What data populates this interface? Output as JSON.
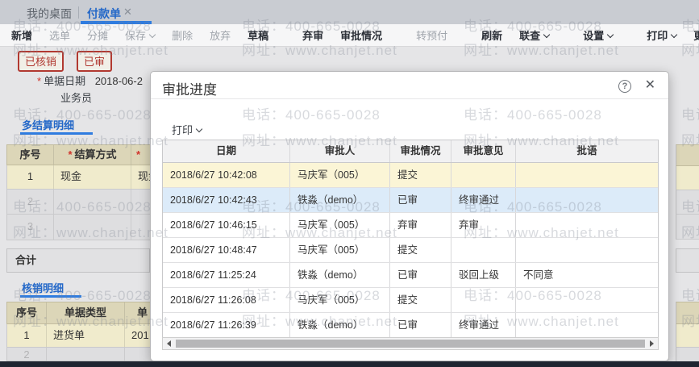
{
  "tabs": [
    {
      "label": "我的桌面"
    },
    {
      "label": "付款单"
    }
  ],
  "icons": {
    "tab_close": "✕",
    "modal_close": "✕",
    "help": "?"
  },
  "toolbar": {
    "items": [
      {
        "label": "新增"
      },
      {
        "label": "选单"
      },
      {
        "label": "分摊"
      },
      {
        "label": "保存"
      },
      {
        "label": "删除"
      },
      {
        "label": "放弃"
      },
      {
        "label": "草稿"
      },
      {
        "label": "弃审"
      },
      {
        "label": "审批情况"
      },
      {
        "label": "转预付"
      },
      {
        "label": "刷新"
      },
      {
        "label": "联查"
      },
      {
        "label": "设置"
      },
      {
        "label": "打印"
      },
      {
        "label": "更多"
      }
    ]
  },
  "badges": [
    "已核销",
    "已审"
  ],
  "form": {
    "required_mark": "*",
    "doc_date_label": "单据日期",
    "doc_date_value": "2018-06-2",
    "salesman_label": "业务员"
  },
  "settle": {
    "tab_label": "多结算明细",
    "headers": [
      "序号",
      "结算方式",
      ""
    ],
    "row1": [
      "1",
      "现金",
      "现金"
    ],
    "row_nums": [
      "2",
      "3"
    ]
  },
  "total_label": "合计",
  "writeoff": {
    "tab_label": "核销明细",
    "headers": [
      "序号",
      "单据类型",
      "单"
    ],
    "row1": [
      "1",
      "进货单",
      "201"
    ],
    "row2_num": "2"
  },
  "watermark": {
    "phone": "电话：400-665-0028",
    "site": "网址：www.chanjet.net"
  },
  "modal": {
    "title": "审批进度",
    "print_label": "打印",
    "table": {
      "headers": [
        "日期",
        "审批人",
        "审批情况",
        "审批意见",
        "批语"
      ],
      "rows": [
        [
          "2018/6/27 10:42:08",
          "马庆军（005）",
          "提交",
          "",
          ""
        ],
        [
          "2018/6/27 10:42:43",
          "铁淼（demo）",
          "已审",
          "终审通过",
          ""
        ],
        [
          "2018/6/27 10:46:15",
          "马庆军（005）",
          "弃审",
          "弃审",
          ""
        ],
        [
          "2018/6/27 10:48:47",
          "马庆军（005）",
          "提交",
          "",
          ""
        ],
        [
          "2018/6/27 11:25:24",
          "铁淼（demo）",
          "已审",
          "驳回上级",
          "不同意"
        ],
        [
          "2018/6/27 11:26:08",
          "马庆军（005）",
          "提交",
          "",
          ""
        ],
        [
          "2018/6/27 11:26:39",
          "铁淼（demo）",
          "已审",
          "终审通过",
          ""
        ]
      ]
    }
  },
  "colors": {
    "accent_blue": "#2f7ce0",
    "badge_red": "#b13931",
    "row_highlight_yellow": "#fbf5d6",
    "row_selected_blue": "#dcebf9",
    "grid_header_khaki": "#dcd6b8",
    "bottom_bar": "#1f2531"
  }
}
